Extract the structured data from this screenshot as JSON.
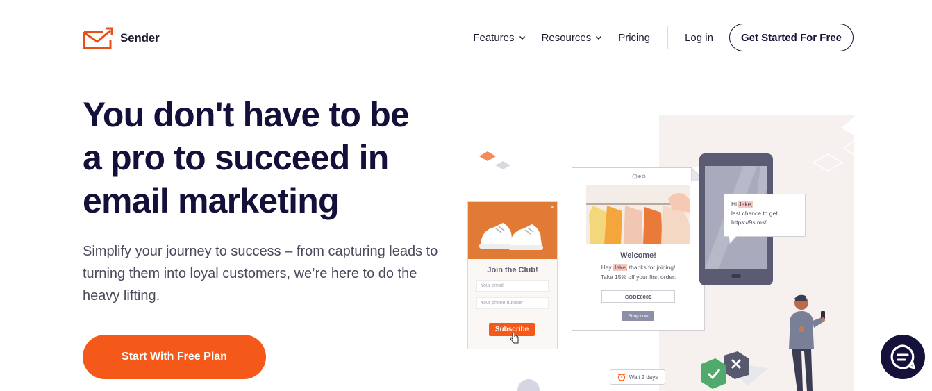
{
  "brand": {
    "name": "Sender",
    "accent": "#f5591a",
    "navy": "#14123a"
  },
  "nav": {
    "features": "Features",
    "resources": "Resources",
    "pricing": "Pricing",
    "login": "Log in",
    "cta": "Get Started For Free"
  },
  "hero": {
    "title_line1": "You don't have to be",
    "title_line2": "a pro to succeed in",
    "title_line3": "email marketing",
    "subtitle": "Simplify your journey to success – from capturing leads to turning them into loyal customers, we’re here to do the heavy lifting.",
    "cta": "Start With Free Plan"
  },
  "illustration": {
    "popup": {
      "close": "×",
      "title": "Join the Club!",
      "email_placeholder": "Your email",
      "phone_placeholder": "Your phone number",
      "button": "Subscribe"
    },
    "email": {
      "welcome": "Welcome!",
      "line1_prefix": "Hey ",
      "name": "Jake,",
      "line1_suffix": " thanks for joining!",
      "line2": "Take 15% off your first order:",
      "code": "CODE0000",
      "shop": "Shop now"
    },
    "sms": {
      "greet": "Hi ",
      "name": "Jake,",
      "line2": "last chance to get...",
      "line3": "https://9s.ms/..."
    },
    "wait": "Wait 2 days"
  },
  "chat": {
    "icon": "chat-icon"
  }
}
